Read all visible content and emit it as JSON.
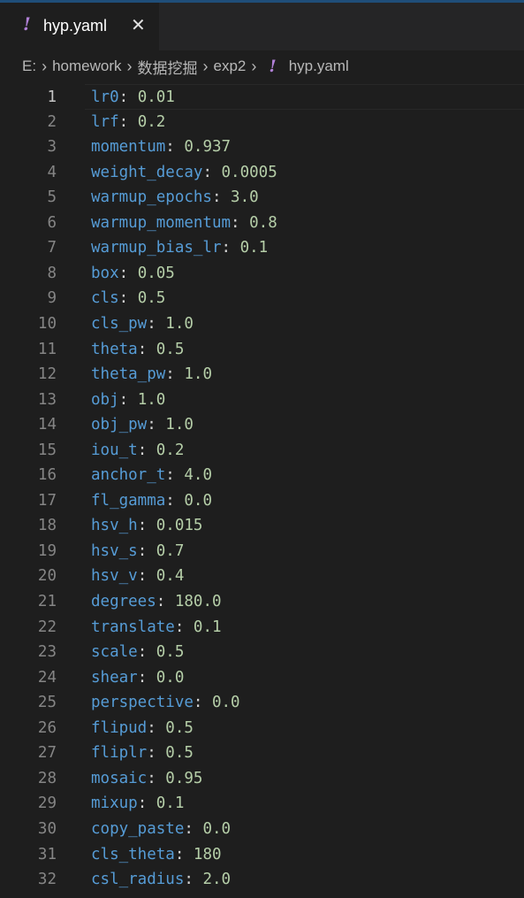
{
  "tab": {
    "icon": "yaml-exclamation-icon",
    "icon_glyph": "!",
    "label": "hyp.yaml",
    "close_glyph": "✕"
  },
  "breadcrumb": {
    "items": [
      "E:",
      "homework",
      "数据挖掘",
      "exp2"
    ],
    "file_icon_glyph": "!",
    "file": "hyp.yaml"
  },
  "colors": {
    "key": "#569cd6",
    "value": "#b5cea8",
    "line_number": "#858585",
    "yaml_icon": "#b180d7",
    "background": "#1e1e1e"
  },
  "editor": {
    "lines": [
      {
        "n": "1",
        "key": "lr0",
        "value": "0.01"
      },
      {
        "n": "2",
        "key": "lrf",
        "value": "0.2"
      },
      {
        "n": "3",
        "key": "momentum",
        "value": "0.937"
      },
      {
        "n": "4",
        "key": "weight_decay",
        "value": "0.0005"
      },
      {
        "n": "5",
        "key": "warmup_epochs",
        "value": "3.0"
      },
      {
        "n": "6",
        "key": "warmup_momentum",
        "value": "0.8"
      },
      {
        "n": "7",
        "key": "warmup_bias_lr",
        "value": "0.1"
      },
      {
        "n": "8",
        "key": "box",
        "value": "0.05"
      },
      {
        "n": "9",
        "key": "cls",
        "value": "0.5"
      },
      {
        "n": "10",
        "key": "cls_pw",
        "value": "1.0"
      },
      {
        "n": "11",
        "key": "theta",
        "value": "0.5"
      },
      {
        "n": "12",
        "key": "theta_pw",
        "value": "1.0"
      },
      {
        "n": "13",
        "key": "obj",
        "value": "1.0"
      },
      {
        "n": "14",
        "key": "obj_pw",
        "value": "1.0"
      },
      {
        "n": "15",
        "key": "iou_t",
        "value": "0.2"
      },
      {
        "n": "16",
        "key": "anchor_t",
        "value": "4.0"
      },
      {
        "n": "17",
        "key": "fl_gamma",
        "value": "0.0"
      },
      {
        "n": "18",
        "key": "hsv_h",
        "value": "0.015"
      },
      {
        "n": "19",
        "key": "hsv_s",
        "value": "0.7"
      },
      {
        "n": "20",
        "key": "hsv_v",
        "value": "0.4"
      },
      {
        "n": "21",
        "key": "degrees",
        "value": "180.0"
      },
      {
        "n": "22",
        "key": "translate",
        "value": "0.1"
      },
      {
        "n": "23",
        "key": "scale",
        "value": "0.5"
      },
      {
        "n": "24",
        "key": "shear",
        "value": "0.0"
      },
      {
        "n": "25",
        "key": "perspective",
        "value": "0.0"
      },
      {
        "n": "26",
        "key": "flipud",
        "value": "0.5"
      },
      {
        "n": "27",
        "key": "fliplr",
        "value": "0.5"
      },
      {
        "n": "28",
        "key": "mosaic",
        "value": "0.95"
      },
      {
        "n": "29",
        "key": "mixup",
        "value": "0.1"
      },
      {
        "n": "30",
        "key": "copy_paste",
        "value": "0.0"
      },
      {
        "n": "31",
        "key": "cls_theta",
        "value": "180"
      },
      {
        "n": "32",
        "key": "csl_radius",
        "value": "2.0"
      },
      {
        "n": "33",
        "key": "",
        "value": ""
      }
    ]
  }
}
